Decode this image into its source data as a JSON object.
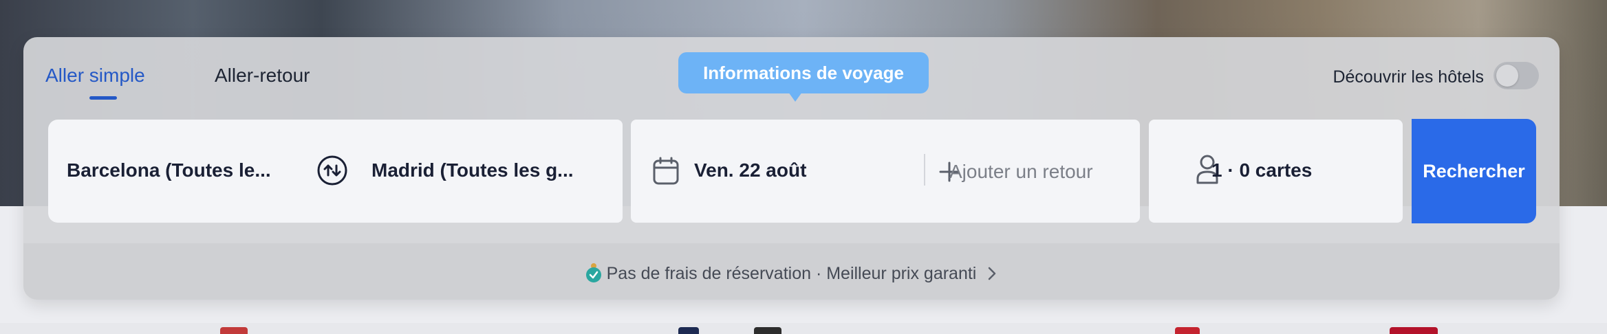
{
  "trip_tabs": {
    "one_way": "Aller simple",
    "round_trip": "Aller-retour"
  },
  "tooltip": {
    "text": "Informations de voyage"
  },
  "hotels_toggle": {
    "label": "Découvrir les hôtels",
    "checked": false
  },
  "search_form": {
    "origin": "Barcelona (Toutes le...",
    "destination": "Madrid (Toutes les g...",
    "departure_date": "Ven. 22 août",
    "add_return": "Ajouter un retour",
    "passengers": "1 · 0 cartes",
    "search_button": "Rechercher"
  },
  "footer": {
    "guarantee_text": "Pas de frais de réservation · Meilleur prix garanti"
  },
  "colors": {
    "accent": "#2458c6",
    "search_button": "#2a6ae8",
    "tooltip": "#6db3f6"
  },
  "icons": [
    "swap-icon",
    "calendar-icon",
    "plus-icon",
    "user-icon",
    "badge-check-icon",
    "chevron-right-icon"
  ]
}
